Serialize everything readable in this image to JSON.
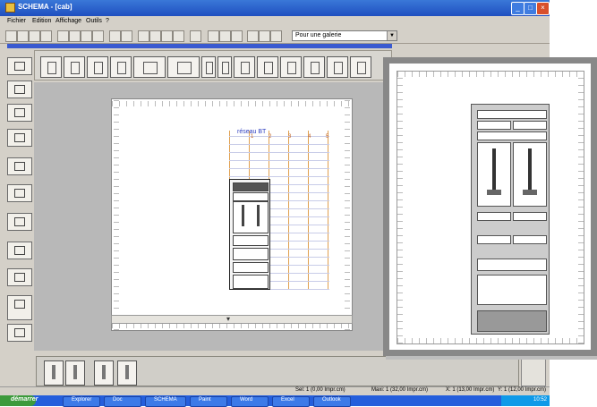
{
  "window": {
    "title": "SCHEMA - [cab]",
    "controls": {
      "minimize": "_",
      "maximize": "□",
      "close": "×"
    }
  },
  "menu": {
    "items": [
      "Fichier",
      "Edition",
      "Affichage",
      "Outils",
      "?"
    ]
  },
  "toolbar": {
    "combo_value": "Pour une galerie"
  },
  "drawing": {
    "grid_title": "réseau BT",
    "column_numbers": [
      "1",
      "2",
      "3",
      "4",
      "5"
    ]
  },
  "status": {
    "left": "Sel: 1 (0,00 Impr.cm)",
    "mid": "Maxi: 1 (32,00 Impr.cm)",
    "right": "X: 1 (13,00 Impr.cm)",
    "far": "Y: 1 (12,00 Impr.cm)"
  },
  "taskbar": {
    "start_label": "démarrer",
    "tasks": [
      "Explorer",
      "Doc",
      "SCHEMA",
      "Paint",
      "Word",
      "Excel",
      "Outlook"
    ],
    "clock": "10:52"
  },
  "colors": {
    "title_blue": "#1f4fc0",
    "taskbar_blue": "#245edc",
    "start_green": "#3c9a3c"
  }
}
